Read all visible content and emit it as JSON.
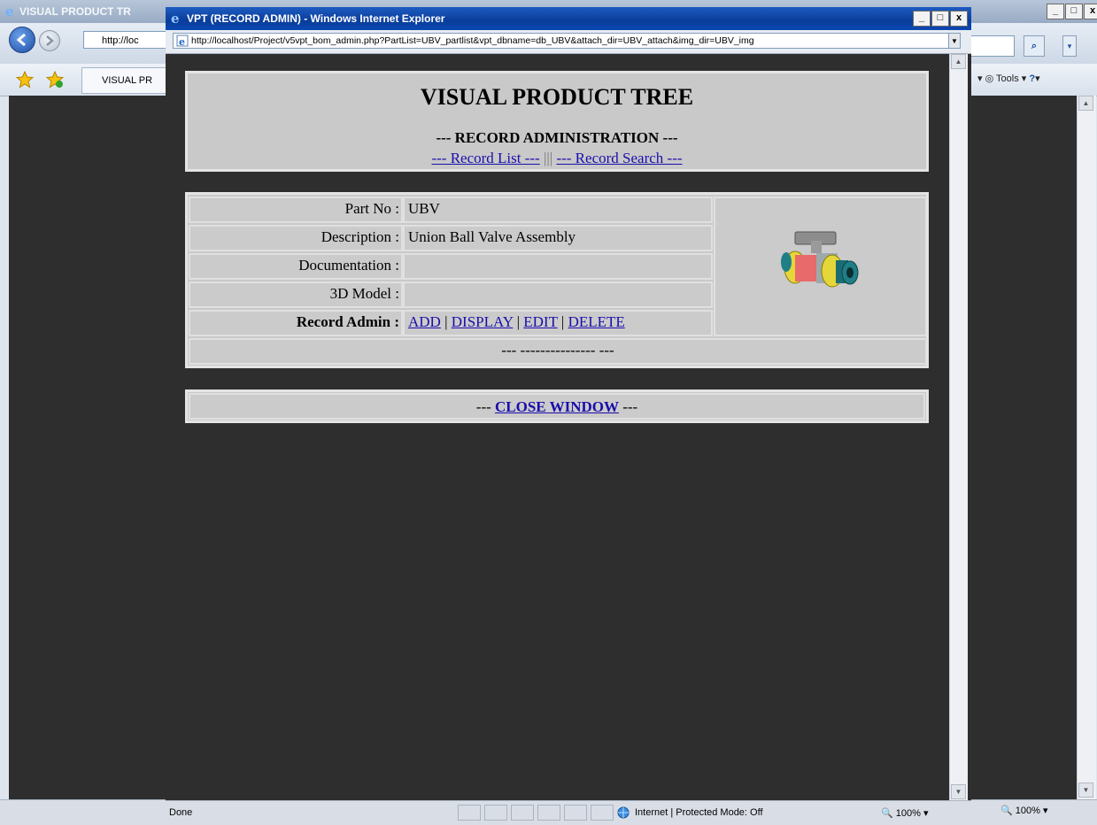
{
  "background_window": {
    "title": "VISUAL PRODUCT TR",
    "address_text": "http://loc",
    "tab_label": "VISUAL PR",
    "tools_label": "Tools",
    "zoom": "100%"
  },
  "popup": {
    "title": "VPT (RECORD ADMIN) - Windows Internet Explorer",
    "url": "http://localhost/Project/v5vpt_bom_admin.php?PartList=UBV_partlist&vpt_dbname=db_UBV&attach_dir=UBV_attach&img_dir=UBV_img",
    "status": "Done",
    "zone": "Internet | Protected Mode: Off",
    "zoom": "100%"
  },
  "page": {
    "title": "VISUAL PRODUCT TREE",
    "subtitle": "--- RECORD ADMINISTRATION ---",
    "record_list_link": "--- Record List ---",
    "nav_separator": "|||",
    "record_search_link": "--- Record Search ---",
    "fields": {
      "part_no_label": "Part No :",
      "part_no_value": "UBV",
      "description_label": "Description :",
      "description_value": "Union Ball Valve Assembly",
      "documentation_label": "Documentation :",
      "documentation_value": "",
      "model_label": "3D Model :",
      "model_value": "",
      "record_admin_label": "Record Admin :"
    },
    "actions": {
      "add": "ADD",
      "display": "DISPLAY",
      "edit": "EDIT",
      "delete": "DELETE",
      "sep": "|"
    },
    "footer_line": "--- --------------- ---",
    "close_prefix": "---",
    "close_label": "CLOSE WINDOW",
    "close_suffix": "---"
  },
  "icons": {
    "ie": "ie-logo-icon",
    "back": "back-arrow-icon",
    "forward": "forward-arrow-icon",
    "search": "search-icon",
    "globe": "globe-icon",
    "favorites": "star-icon",
    "product": "ball-valve-image"
  }
}
